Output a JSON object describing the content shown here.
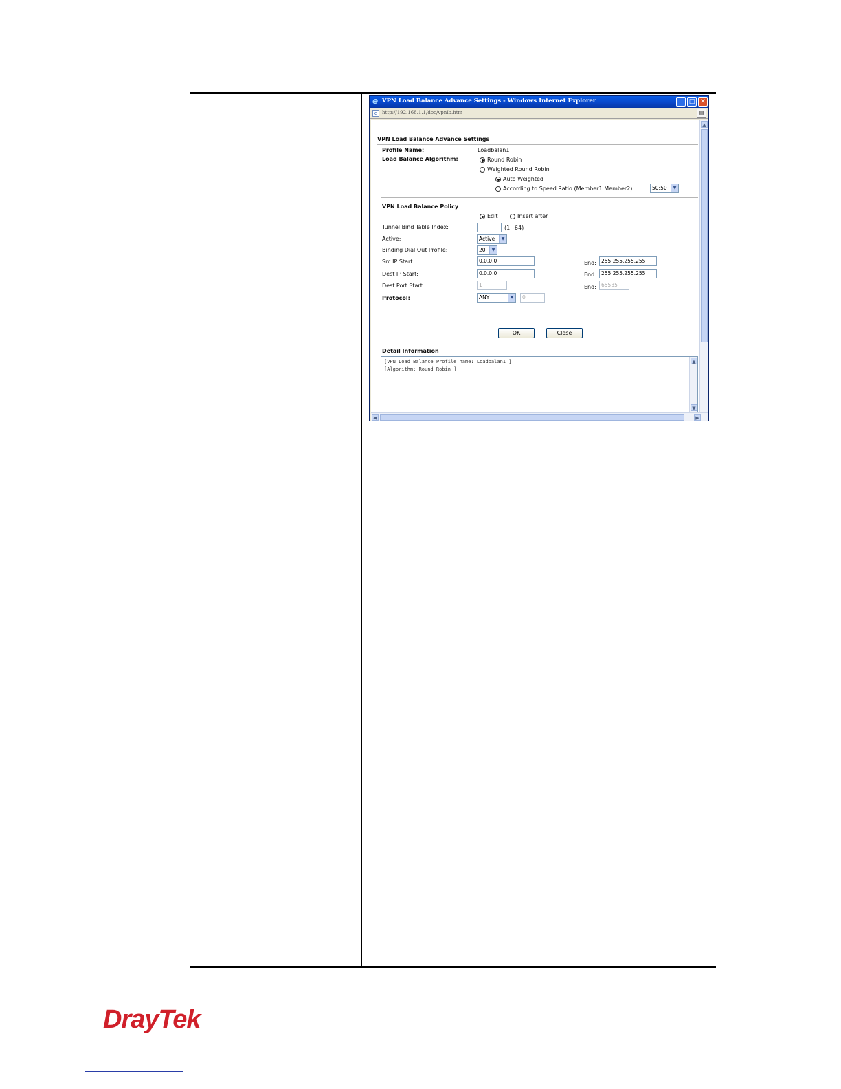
{
  "window": {
    "title": "VPN Load Balance Advance Settings - Windows Internet Explorer",
    "address": "http://192.168.1.1/doc/vpnlb.htm",
    "min_glyph": "_",
    "max_glyph": "□",
    "close_glyph": "✕"
  },
  "form": {
    "heading": "VPN Load Balance Advance Settings",
    "profile_name_label": "Profile Name:",
    "profile_name_value": "Loadbalan1",
    "algorithm_label": "Load Balance Algorithm:",
    "algorithm_options": {
      "round_robin": "Round Robin",
      "weighted_round_robin": "Weighted Round Robin",
      "auto_weighted": "Auto Weighted",
      "speed_ratio": "According to Speed Ratio (Member1:Member2):"
    },
    "speed_ratio_value": "50:50",
    "algorithm_selected": "Round Robin",
    "policy_heading": "VPN Load Balance Policy",
    "mode_edit": "Edit",
    "mode_insert_after": "Insert after",
    "tunnel_index_label": "Tunnel Bind Table Index:",
    "tunnel_index_value": "",
    "tunnel_index_range": "(1~64)",
    "active_label": "Active:",
    "active_value": "Active",
    "binding_label": "Binding Dial Out Profile:",
    "binding_value": "20",
    "src_ip_label": "Src IP Start:",
    "src_ip_start": "0.0.0.0",
    "src_ip_end_label": "End:",
    "src_ip_end": "255.255.255.255",
    "dest_ip_label": "Dest IP Start:",
    "dest_ip_start": "0.0.0.0",
    "dest_ip_end_label": "End:",
    "dest_ip_end": "255.255.255.255",
    "dest_port_label": "Dest Port Start:",
    "dest_port_start": "1",
    "dest_port_end_label": "End:",
    "dest_port_end": "65535",
    "protocol_label": "Protocol:",
    "protocol_value": "ANY",
    "protocol_number": "0",
    "ok_label": "OK",
    "close_label": "Close",
    "detail_heading": "Detail Information",
    "detail_lines": [
      "[VPN Load Balance Profile name: Loadbalan1 ]",
      "[Algorithm: Round Robin ]"
    ]
  },
  "footer": {
    "logo_text": "DrayTek"
  },
  "colors": {
    "titlebar": "#0a5ee8",
    "logo": "#d0202a"
  }
}
